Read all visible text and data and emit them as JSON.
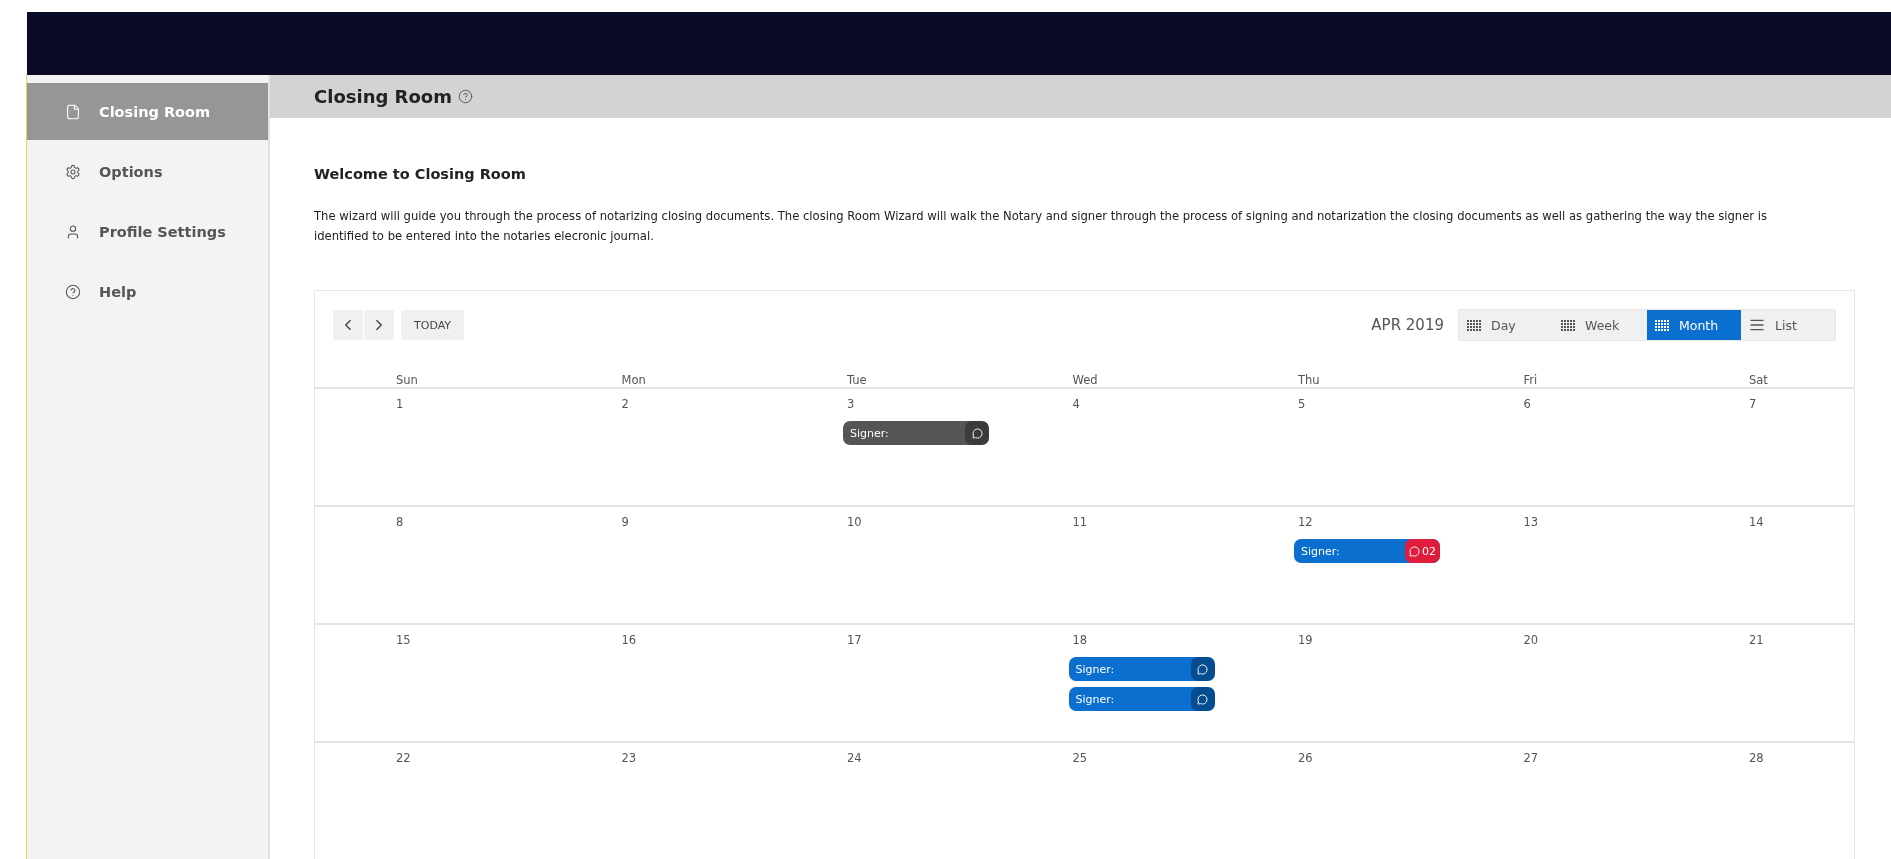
{
  "sidebar": {
    "items": [
      {
        "label": "Closing Room",
        "selected": true
      },
      {
        "label": "Options",
        "selected": false
      },
      {
        "label": "Profile Settings",
        "selected": false
      },
      {
        "label": "Help",
        "selected": false
      }
    ]
  },
  "header": {
    "title": "Closing Room"
  },
  "intro": {
    "heading": "Welcome to Closing Room",
    "text": "The wizard will guide you through the process of notarizing closing documents. The closing Room Wizard will walk the Notary and signer through the process of signing and notarization the closing documents as well as gathering the way the signer is identified to be entered into the notaries elecronic journal."
  },
  "calendar": {
    "today_button": "TODAY",
    "period": "APR 2019",
    "views": [
      {
        "label": "Day",
        "selected": false
      },
      {
        "label": "Week",
        "selected": false
      },
      {
        "label": "Month",
        "selected": true
      },
      {
        "label": "List",
        "selected": false
      }
    ],
    "weekdays": [
      "Sun",
      "Mon",
      "Tue",
      "Wed",
      "Thu",
      "Fri",
      "Sat"
    ],
    "weeks": [
      [
        {
          "day": "1"
        },
        {
          "day": "2"
        },
        {
          "day": "3",
          "events": [
            {
              "title": "Signer:",
              "color": "#555555",
              "alert": false
            }
          ]
        },
        {
          "day": "4"
        },
        {
          "day": "5"
        },
        {
          "day": "6"
        },
        {
          "day": "7"
        }
      ],
      [
        {
          "day": "8"
        },
        {
          "day": "9"
        },
        {
          "day": "10"
        },
        {
          "day": "11"
        },
        {
          "day": "12",
          "events": [
            {
              "title": "Signer:",
              "color": "#0a6fcf",
              "alert": true,
              "count": "02"
            }
          ]
        },
        {
          "day": "13"
        },
        {
          "day": "14"
        }
      ],
      [
        {
          "day": "15"
        },
        {
          "day": "16"
        },
        {
          "day": "17"
        },
        {
          "day": "18",
          "events": [
            {
              "title": "Signer:",
              "color": "#0a6fcf",
              "alert": false
            },
            {
              "title": "Signer:",
              "color": "#0a6fcf",
              "alert": false
            }
          ]
        },
        {
          "day": "19"
        },
        {
          "day": "20"
        },
        {
          "day": "21"
        }
      ],
      [
        {
          "day": "22"
        },
        {
          "day": "23"
        },
        {
          "day": "24"
        },
        {
          "day": "25"
        },
        {
          "day": "26"
        },
        {
          "day": "27"
        },
        {
          "day": "28"
        }
      ]
    ]
  }
}
